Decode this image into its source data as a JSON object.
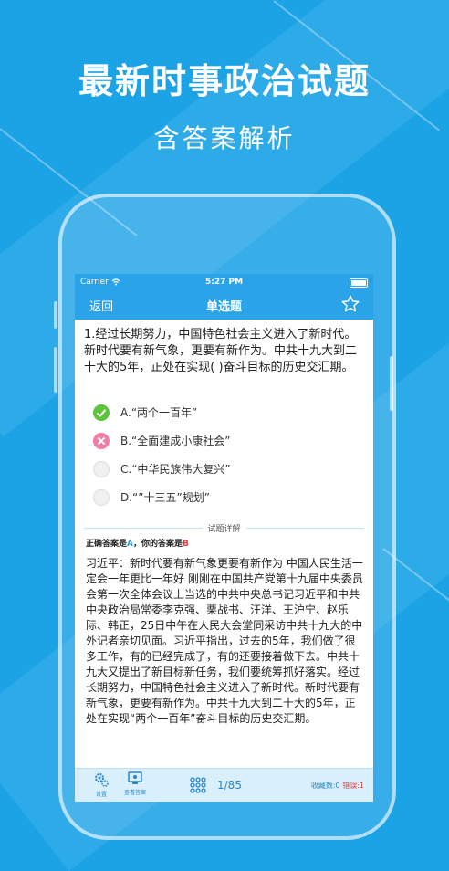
{
  "promo": {
    "headline": "最新时事政治试题",
    "subline": "含答案解析"
  },
  "status_bar": {
    "carrier": "Carrier",
    "time": "5:27 PM"
  },
  "nav": {
    "back": "返回",
    "title": "单选题",
    "star_icon": "star-outline-icon"
  },
  "question": {
    "text": "1.经过长期努力，中国特色社会主义进入了新时代。新时代要有新气象，更要有新作为。中共十九大到二十大的5年，正处在实现( )奋斗目标的历史交汇期。",
    "options": [
      {
        "label": "A.“两个一百年”",
        "state": "correct"
      },
      {
        "label": "B.“全面建成小康社会”",
        "state": "wrong"
      },
      {
        "label": "C.“中华民族伟大复兴”",
        "state": "none"
      },
      {
        "label": "D.“”十三五”规划”",
        "state": "none"
      }
    ]
  },
  "analysis": {
    "section_title": "试题详解",
    "correct_prefix": "正确答案是",
    "correct_value": "A",
    "your_prefix": "，你的答案是",
    "your_value": "B",
    "body": "习近平：新时代要有新气象更要有新作为 中国人民生活一定会一年更比一年好 刚刚在中国共产党第十九届中央委员会第一次全体会议上当选的中共中央总书记习近平和中共中央政治局常委李克强、栗战书、汪洋、王沪宁、赵乐际、韩正，25日中午在人民大会堂同采访中共十九大的中外记者亲切见面。习近平指出，过去的5年，我们做了很多工作，有的已经完成了，有的还要接着做下去。中共十九大又提出了新目标新任务，我们要统筹抓好落实。经过长期努力，中国特色社会主义进入了新时代。新时代要有新气象，更要有新作为。中共十九大到二十大的5年，正处在实现“两个一百年”奋斗目标的历史交汇期。"
  },
  "bottom_bar": {
    "settings_label": "设置",
    "view_answer_label": "查看答案",
    "progress": "1/85",
    "favorites": "收藏数:0",
    "errors": "错误:1"
  },
  "colors": {
    "background": "#1ca3e6",
    "nav": "#2aa3e8",
    "correct": "#5cc33b",
    "wrong": "#f27ca6"
  }
}
